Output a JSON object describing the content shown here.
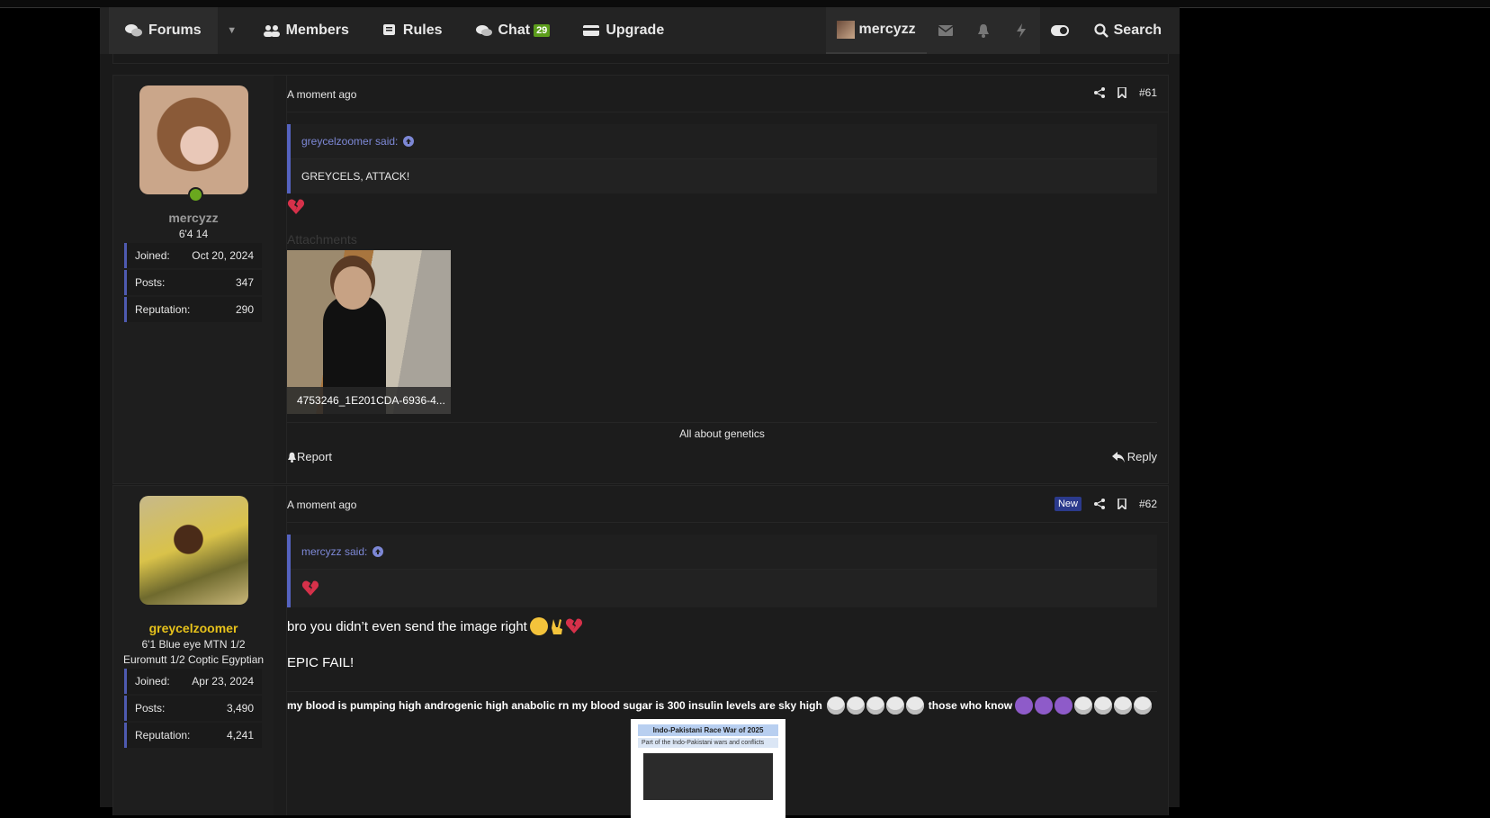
{
  "nav": {
    "forums": "Forums",
    "members": "Members",
    "rules": "Rules",
    "chat": "Chat",
    "chat_badge": "29",
    "upgrade": "Upgrade",
    "username": "mercyzz",
    "search": "Search"
  },
  "posts": [
    {
      "time": "A moment ago",
      "number": "#61",
      "user": {
        "name": "mercyzz",
        "title": "6'4 14",
        "joined_label": "Joined:",
        "joined": "Oct 20, 2024",
        "posts_label": "Posts:",
        "posts": "347",
        "rep_label": "Reputation:",
        "rep": "290"
      },
      "quote_author": "greycelzoomer said:",
      "quote_text": "GREYCELS, ATTACK!",
      "attachments_label": "Attachments",
      "attachment_name": "4753246_1E201CDA-6936-4...",
      "signature": "All about genetics",
      "report": "Report",
      "reply": "Reply"
    },
    {
      "time": "A moment ago",
      "new_tag": "New",
      "number": "#62",
      "user": {
        "name": "greycelzoomer",
        "title_line1": "6'1 Blue eye MTN 1/2",
        "title_line2": "Euromutt 1/2 Coptic Egyptian",
        "joined_label": "Joined:",
        "joined": "Apr 23, 2024",
        "posts_label": "Posts:",
        "posts": "3,490",
        "rep_label": "Reputation:",
        "rep": "4,241"
      },
      "quote_author": "mercyzz said:",
      "body_line1": "bro you didn’t even send the image right",
      "body_line2": "EPIC FAIL!",
      "signature_part1": "my blood is pumping high androgenic high anabolic rn my blood sugar is 300 insulin levels are sky high",
      "signature_part2": "those who know",
      "sig_image_title": "Indo-Pakistani Race War of 2025",
      "sig_image_sub": "Part of the Indo-Pakistani wars and conflicts"
    }
  ],
  "colors": {
    "accent": "#5563c0",
    "online": "#6aa81e",
    "gold_name": "#e7c21b",
    "chat_badge": "#5c9d1c",
    "new_tag": "#2b3a8c"
  }
}
